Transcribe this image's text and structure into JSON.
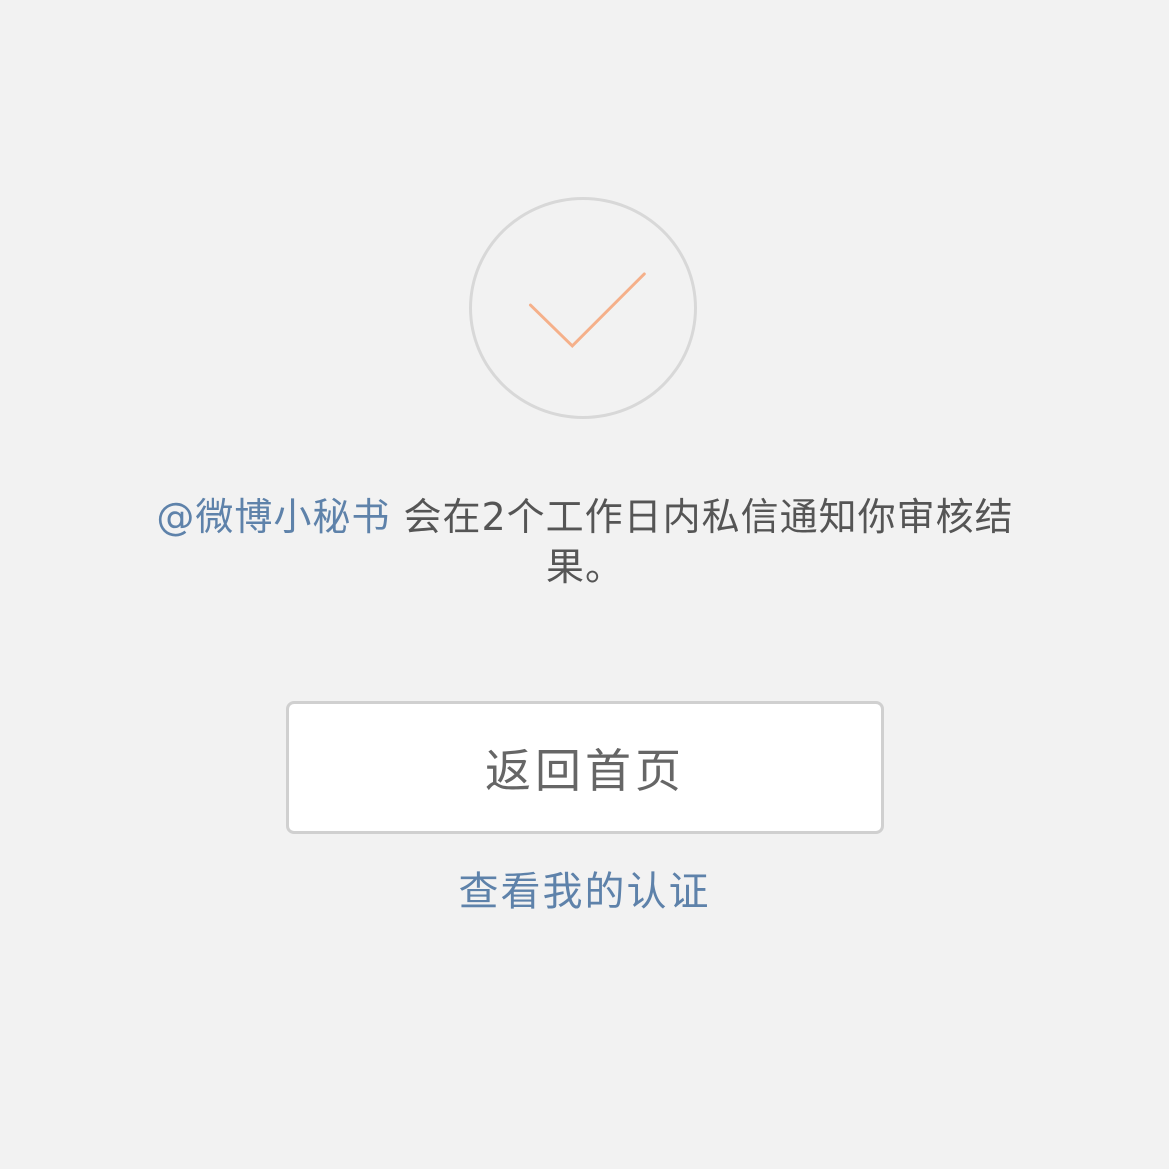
{
  "status": {
    "icon": "check-circle-icon",
    "check_color": "#f5b08a",
    "circle_color": "#d8d8d8"
  },
  "message": {
    "mention": "@微博小秘书",
    "text": " 会在2个工作日内私信通知你审核结果。",
    "mention_color": "#5e82aa"
  },
  "actions": {
    "home_button_label": "返回首页",
    "verify_link_label": "查看我的认证"
  }
}
